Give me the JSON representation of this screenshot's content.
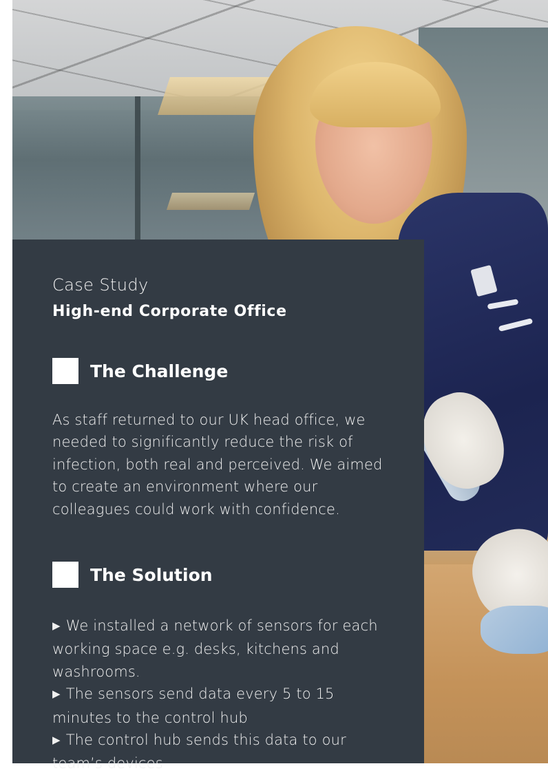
{
  "case_study": {
    "eyebrow": "Case Study",
    "title": "High-end Corporate Office"
  },
  "challenge": {
    "heading": "The Challenge",
    "text": "As staff returned to our UK head office, we needed to significantly reduce the risk of infection, both real and perceived. We aimed to create an environment where our colleagues could work with confidence."
  },
  "solution": {
    "heading": "The Solution",
    "bullets": [
      "We installed a network of sensors for each working space e.g. desks, kitchens and washrooms.",
      "The sensors send data every 5 to 15 minutes to the control hub",
      "The control hub sends this data to our team’s devices"
    ]
  },
  "colors": {
    "panel": "#333b44",
    "text": "#ffffff",
    "accent_square": "#ffffff"
  },
  "icons": {
    "section_marker": "white-square-icon",
    "bullet": "triangle-right-icon"
  }
}
